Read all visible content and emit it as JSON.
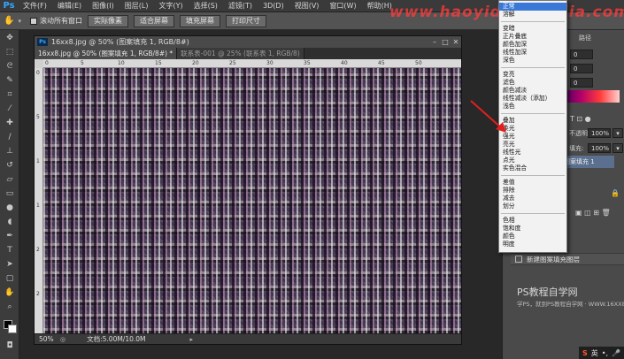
{
  "app": {
    "logo": "Ps"
  },
  "menu": [
    "文件(F)",
    "编辑(E)",
    "图像(I)",
    "图层(L)",
    "文字(Y)",
    "选择(S)",
    "滤镜(T)",
    "3D(D)",
    "视图(V)",
    "窗口(W)",
    "帮助(H)"
  ],
  "options_bar": {
    "scroll_all_label": "滚动所有窗口",
    "buttons": [
      "实际像素",
      "适合屏幕",
      "填充屏幕",
      "打印尺寸"
    ]
  },
  "watermark": "www.haoyidianshejia.com",
  "document": {
    "title": "16xx8.jpg @ 50% (图案填充 1, RGB/8#)",
    "tabs": [
      "16xx8.jpg @ 50% (图案填充 1, RGB/8#) *",
      "联系表-001 @ 25% (联系表 1, RGB/8)"
    ],
    "ruler_top_ticks": [
      "0",
      "5",
      "10",
      "15",
      "20",
      "25",
      "30",
      "35",
      "40",
      "45",
      "50"
    ],
    "ruler_left_ticks": [
      "0",
      "5",
      "1",
      "1",
      "2",
      "2"
    ],
    "zoom": "50%",
    "doc_info": "文档:5.00M/10.0M"
  },
  "blend_modes": {
    "selected": "正常",
    "groups": [
      [
        "正常",
        "溶解"
      ],
      [
        "变暗",
        "正片叠底",
        "颜色加深",
        "线性加深",
        "深色"
      ],
      [
        "变亮",
        "滤色",
        "颜色减淡",
        "线性减淡（添加）",
        "浅色"
      ],
      [
        "叠加",
        "柔光",
        "强光",
        "亮光",
        "线性光",
        "点光",
        "实色混合"
      ],
      [
        "差值",
        "排除",
        "减去",
        "划分"
      ],
      [
        "色相",
        "饱和度",
        "颜色",
        "明度"
      ]
    ]
  },
  "right_panel": {
    "fields": [
      "0",
      "0",
      "0"
    ],
    "tab_label": "路径",
    "opacity_label": "不透明度:",
    "opacity_value": "100%",
    "fill_label": "填充:",
    "fill_value": "100%",
    "layer_name": "图案填充 1",
    "new_layer_label": "新建图案填充图层",
    "brand": "PS教程自学网",
    "brand_sub": "学PS，就到PS教程自学网 · WWW.16XX8.COM"
  },
  "ime": {
    "s": "S",
    "lang": "英"
  },
  "colors": {
    "selection_blue": "#3a78d8",
    "watermark_red": "#ff3c3c",
    "ps_blue": "#31a8ff"
  }
}
